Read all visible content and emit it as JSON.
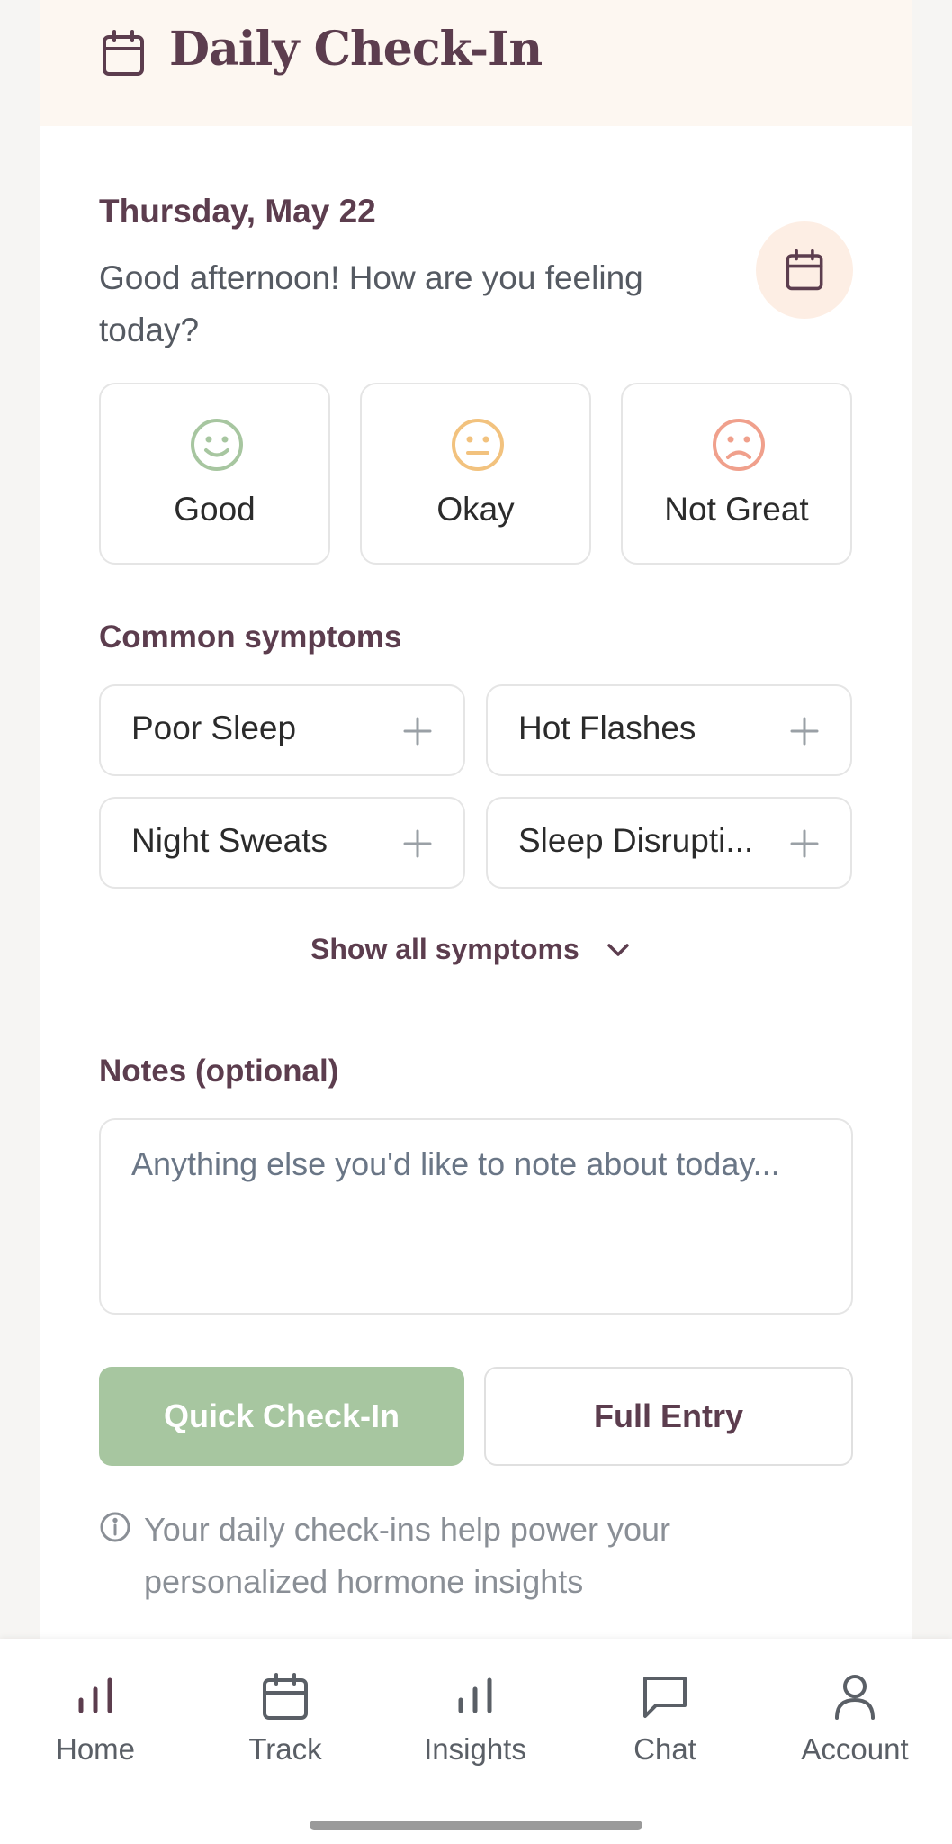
{
  "header": {
    "title": "Daily Check-In",
    "icon": "calendar-icon"
  },
  "checkin": {
    "date": "Thursday, May 22",
    "greeting": "Good afternoon! How are you feeling today?",
    "calendar_icon": "calendar-icon"
  },
  "moods": [
    {
      "label": "Good",
      "icon": "smile-icon",
      "color": "#a7c6a0"
    },
    {
      "label": "Okay",
      "icon": "neutral-face-icon",
      "color": "#f2c27e"
    },
    {
      "label": "Not Great",
      "icon": "frown-icon",
      "color": "#f0a08c"
    }
  ],
  "symptoms": {
    "title": "Common symptoms",
    "items": [
      {
        "label": "Poor Sleep"
      },
      {
        "label": "Hot Flashes"
      },
      {
        "label": "Night Sweats"
      },
      {
        "label": "Sleep Disrupti..."
      }
    ],
    "show_all_label": "Show all symptoms"
  },
  "notes": {
    "title": "Notes (optional)",
    "placeholder": "Anything else you'd like to note about today...",
    "value": ""
  },
  "actions": {
    "quick_label": "Quick Check-In",
    "full_label": "Full Entry"
  },
  "info": {
    "text": "Your daily check-ins help power your personalized hormone insights"
  },
  "tabbar": {
    "items": [
      {
        "label": "Home",
        "icon": "bar-chart-icon"
      },
      {
        "label": "Track",
        "icon": "calendar-icon"
      },
      {
        "label": "Insights",
        "icon": "bar-chart-icon"
      },
      {
        "label": "Chat",
        "icon": "chat-bubble-icon"
      },
      {
        "label": "Account",
        "icon": "user-icon"
      }
    ]
  },
  "colors": {
    "accent_plum": "#5c3d4e",
    "accent_green": "#a7c6a0",
    "header_bg": "#fdf7f1"
  }
}
